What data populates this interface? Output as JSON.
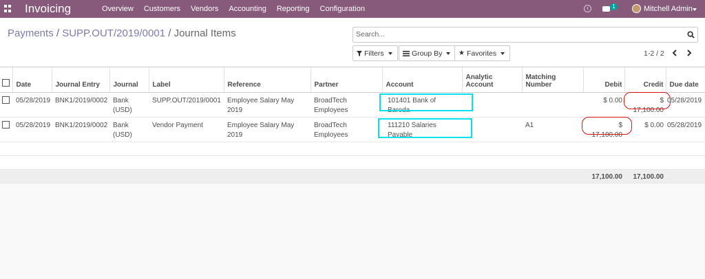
{
  "navbar": {
    "app_name": "Invoicing",
    "menu": [
      "Overview",
      "Customers",
      "Vendors",
      "Accounting",
      "Reporting",
      "Configuration"
    ],
    "chat_badge": "1",
    "user_name": "Mitchell Admin",
    "color": "#875a7b"
  },
  "breadcrumb": {
    "parent": "Payments",
    "record": "SUPP.OUT/2019/0001",
    "current": "Journal Items",
    "sep": "/"
  },
  "search": {
    "placeholder": "Search..."
  },
  "filters": {
    "filters_label": "Filters",
    "groupby_label": "Group By",
    "favorites_label": "Favorites"
  },
  "pager": {
    "value": "1-2 / 2"
  },
  "table": {
    "columns": [
      "Date",
      "Journal Entry",
      "Journal",
      "Label",
      "Reference",
      "Partner",
      "Account",
      "Analytic Account",
      "Matching Number",
      "Debit",
      "Credit",
      "Due date"
    ],
    "rows": [
      {
        "date": "05/28/2019",
        "journal_entry": "BNK1/2019/0002",
        "journal": "Bank (USD)",
        "label": "SUPP.OUT/2019/0001",
        "reference": "Employee Salary May 2019",
        "partner": "BroadTech Employees",
        "account": "101401 Bank of Baroda",
        "analytic": "",
        "matching": "",
        "debit": "$ 0.00",
        "credit": "$ 17,100.00",
        "due_date": "05/28/2019"
      },
      {
        "date": "05/28/2019",
        "journal_entry": "BNK1/2019/0002",
        "journal": "Bank (USD)",
        "label": "Vendor Payment",
        "reference": "Employee Salary May 2019",
        "partner": "BroadTech Employees",
        "account": "111210 Salaries Payable",
        "analytic": "",
        "matching": "A1",
        "debit": "$ 17,100.00",
        "credit": "$ 0.00",
        "due_date": "05/28/2019"
      }
    ],
    "totals": {
      "debit": "17,100.00",
      "credit": "17,100.00"
    }
  },
  "annotations": {
    "cyan": "#00e1f0",
    "red": "#dd1111"
  }
}
